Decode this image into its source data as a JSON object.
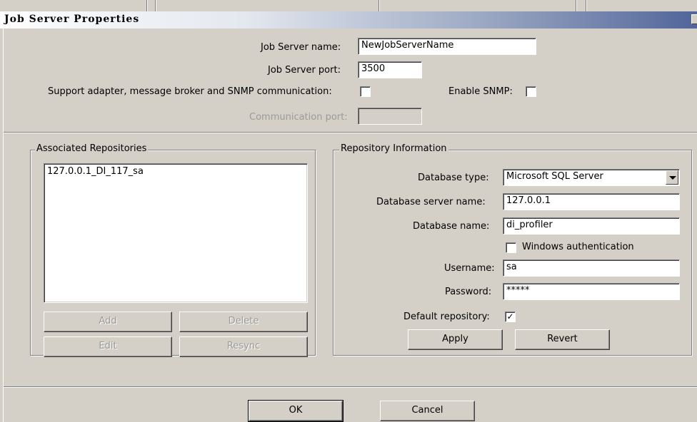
{
  "window": {
    "title": "Job Server Properties"
  },
  "server": {
    "name_label": "Job Server name:",
    "name_value": "NewJobServerName",
    "port_label": "Job Server port:",
    "port_value": "3500",
    "support_label": "Support adapter, message broker and SNMP communication:",
    "support_checked": false,
    "snmp_label": "Enable SNMP:",
    "snmp_checked": false,
    "comm_port_label": "Communication port:",
    "comm_port_value": ""
  },
  "repos": {
    "group_title": "Associated Repositories",
    "items": [
      "127.0.0.1_DI_117_sa"
    ],
    "add_label": "Add",
    "delete_label": "Delete",
    "edit_label": "Edit",
    "resync_label": "Resync"
  },
  "repo_info": {
    "group_title": "Repository Information",
    "db_type_label": "Database type:",
    "db_type_value": "Microsoft SQL Server",
    "db_server_label": "Database server name:",
    "db_server_value": "127.0.0.1",
    "db_name_label": "Database name:",
    "db_name_value": "di_profiler",
    "win_auth_label": "Windows authentication",
    "win_auth_checked": false,
    "username_label": "Username:",
    "username_value": "sa",
    "password_label": "Password:",
    "password_value": "*****",
    "default_label": "Default repository:",
    "default_checked": true,
    "apply_label": "Apply",
    "revert_label": "Revert"
  },
  "footer": {
    "ok_label": "OK",
    "cancel_label": "Cancel"
  }
}
